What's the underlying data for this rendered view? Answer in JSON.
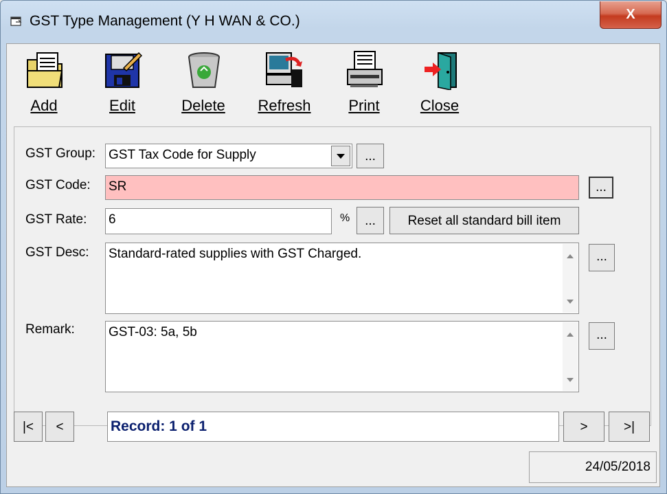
{
  "window": {
    "title": "GST Type Management (Y H WAN & CO.)",
    "close_label": "X"
  },
  "toolbar": {
    "items": [
      {
        "label": "Add",
        "icon": "folder-document-icon"
      },
      {
        "label": "Edit",
        "icon": "floppy-pencil-icon"
      },
      {
        "label": "Delete",
        "icon": "recycle-bin-icon"
      },
      {
        "label": "Refresh",
        "icon": "computer-refresh-icon"
      },
      {
        "label": "Print",
        "icon": "printer-icon"
      },
      {
        "label": "Close",
        "icon": "exit-door-icon"
      }
    ]
  },
  "form": {
    "group_label": "GST Group:",
    "group_value": "GST Tax Code for Supply",
    "code_label": "GST Code:",
    "code_value": "SR",
    "rate_label": "GST Rate:",
    "rate_value": "6",
    "rate_unit": "%",
    "reset_label": "Reset all standard bill item",
    "desc_label": "GST Desc:",
    "desc_value": "Standard-rated supplies with GST Charged.",
    "remark_label": "Remark:",
    "remark_value": "GST-03: 5a, 5b",
    "ellipsis": "..."
  },
  "navigation": {
    "first": "|<",
    "prev": "<",
    "record_text": "Record: 1 of 1",
    "next": ">",
    "last": ">|"
  },
  "status": {
    "date": "24/05/2018"
  },
  "colors": {
    "code_field_bg": "#ffc0c0",
    "record_text": "#0a1f6e"
  }
}
